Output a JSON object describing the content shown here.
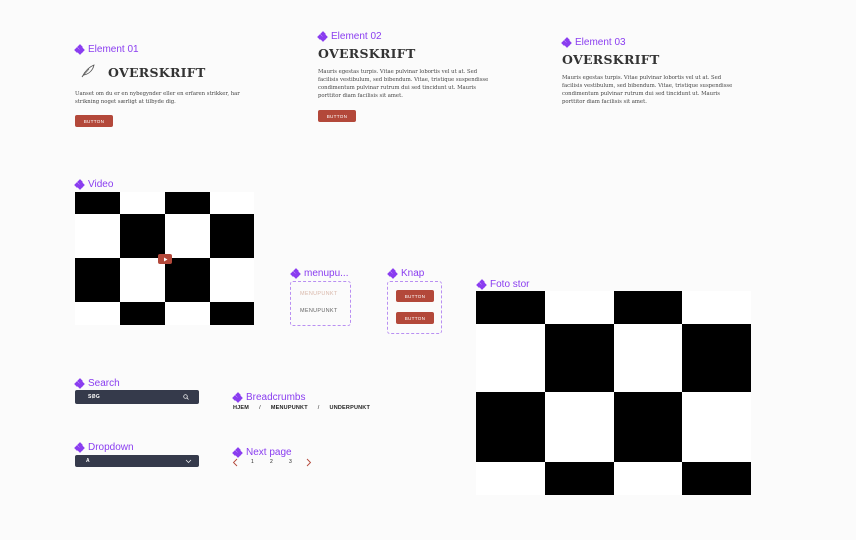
{
  "labels": {
    "element01": "Element 01",
    "element02": "Element 02",
    "element03": "Element 03",
    "video": "Video",
    "menupunkt": "menupu...",
    "knap": "Knap",
    "foto_stor": "Foto stor",
    "search": "Search",
    "breadcrumbs": "Breadcrumbs",
    "dropdown": "Dropdown",
    "next_page": "Next page"
  },
  "element01": {
    "heading": "OVERSKRIFT",
    "body": "Uanset om du er en nybegynder eller en erfaren strikker, har strikning noget særligt at tilbyde dig.",
    "button": "BUTTON"
  },
  "element02": {
    "heading": "OVERSKRIFT",
    "body": "Mauris egestas turpis. Vitae pulvinar lobortis vel ut at. Sed facilisis vestibulum, sed bibendum. Vitae, tristique suspendisse condimentum pulvinar rutrum dui sed tincidunt ut. Mauris porttitor diam facilisis sit amet.",
    "button": "BUTTON"
  },
  "element03": {
    "heading": "OVERSKRIFT",
    "body": "Mauris egestas turpis. Vitae pulvinar lobortis vel ut at. Sed facilisis vestibulum, sed bibendum. Vitae, tristique suspendisse condimentum pulvinar rutrum dui sed tincidunt ut. Mauris porttitor diam facilisis sit amet."
  },
  "menu": {
    "items": [
      "MENUPUNKT",
      "MENUPUNKT"
    ]
  },
  "knap": {
    "buttons": [
      "BUTTON",
      "BUTTON"
    ]
  },
  "search": {
    "placeholder": "SØG"
  },
  "breadcrumbs": {
    "items": [
      "HJEM",
      "MENUPUNKT",
      "UNDERPUNKT"
    ],
    "separator": "/"
  },
  "dropdown": {
    "value": "A"
  },
  "pagination": {
    "pages": [
      "1",
      "2",
      "3"
    ]
  },
  "colors": {
    "accent_purple": "#8a3df0",
    "button_red": "#b3483a",
    "dark_bar": "#353a4b"
  },
  "icons": {
    "brand": "leaf-icon",
    "component": "component-diamond-icon",
    "search": "search-icon",
    "dropdown": "chevron-down-icon",
    "play": "play-icon",
    "prev": "chevron-left-icon",
    "next": "chevron-right-icon"
  }
}
